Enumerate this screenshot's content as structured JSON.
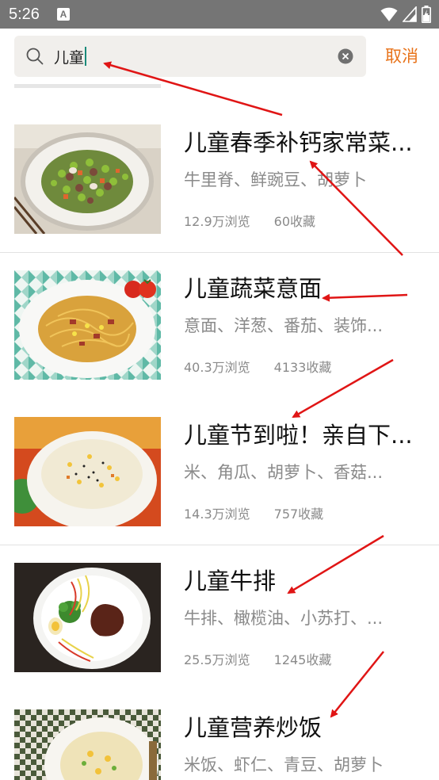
{
  "status_bar": {
    "time": "5:26",
    "notification_letter": "A"
  },
  "search": {
    "query": "儿童",
    "cancel_label": "取消"
  },
  "colors": {
    "accent": "#e8731a",
    "annotation_arrow": "#e01515"
  },
  "recipes": [
    {
      "title": "儿童春季补钙家常菜...",
      "ingredients": "牛里脊、鲜豌豆、胡萝卜",
      "views": "12.9万浏览",
      "favorites": "60收藏"
    },
    {
      "title": "儿童蔬菜意面",
      "ingredients": "意面、洋葱、番茄、装饰...",
      "views": "40.3万浏览",
      "favorites": "4133收藏"
    },
    {
      "title": "儿童节到啦！亲自下...",
      "ingredients": "米、角瓜、胡萝卜、香菇...",
      "views": "14.3万浏览",
      "favorites": "757收藏"
    },
    {
      "title": "儿童牛排",
      "ingredients": "牛排、橄榄油、小苏打、...",
      "views": "25.5万浏览",
      "favorites": "1245收藏"
    },
    {
      "title": "儿童营养炒饭",
      "ingredients": "米饭、虾仁、青豆、胡萝卜"
    }
  ]
}
